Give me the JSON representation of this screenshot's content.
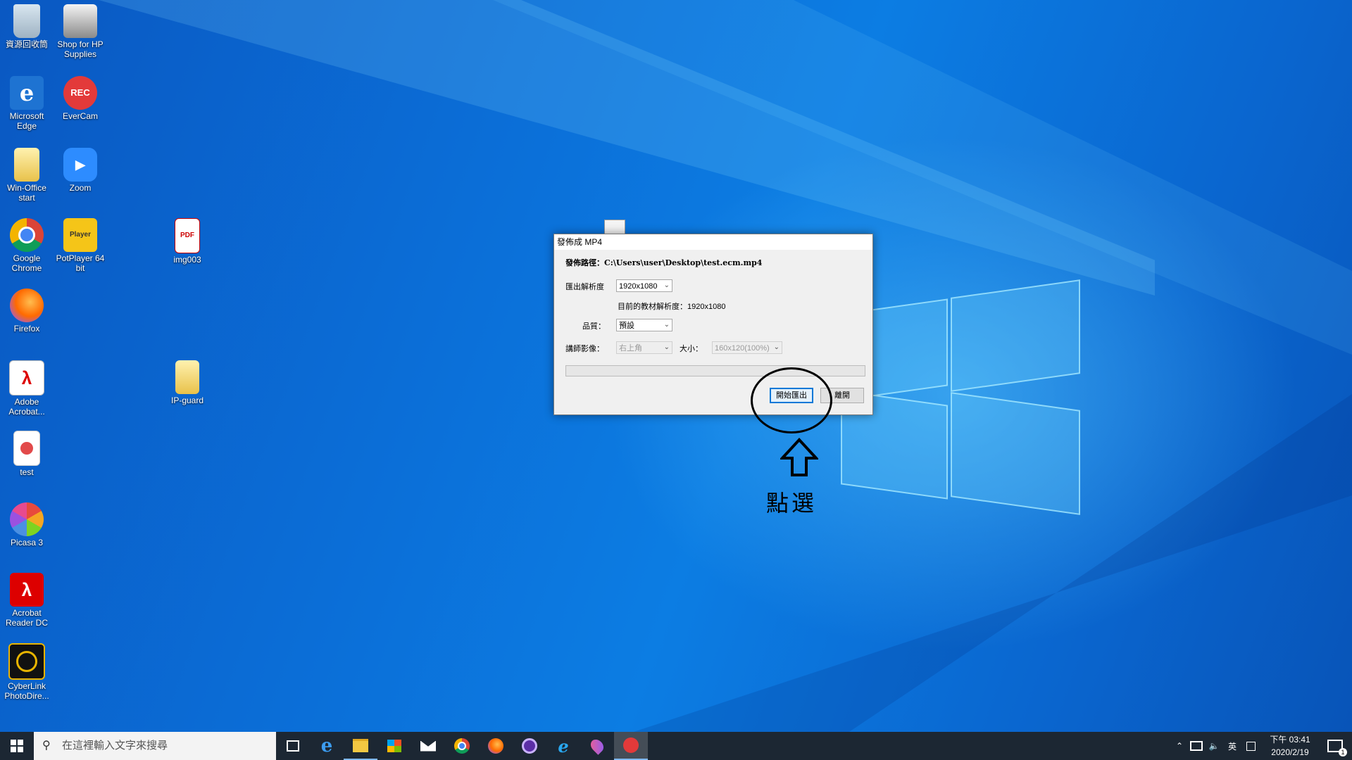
{
  "desktop_icons": [
    {
      "label": "資源回收筒",
      "icon": "recycle-bin-icon"
    },
    {
      "label": "Shop for HP Supplies",
      "icon": "printer-icon"
    },
    {
      "label": "Microsoft Edge",
      "icon": "edge-icon"
    },
    {
      "label": "EverCam",
      "icon": "evercam-icon",
      "badge": "REC"
    },
    {
      "label": "Win-Office start",
      "icon": "folder-icon"
    },
    {
      "label": "Zoom",
      "icon": "zoom-icon"
    },
    {
      "label": "Google Chrome",
      "icon": "chrome-icon"
    },
    {
      "label": "PotPlayer 64 bit",
      "icon": "potplayer-icon",
      "badge": "Player"
    },
    {
      "label": "img003",
      "icon": "pdf-file-icon",
      "badge": "PDF"
    },
    {
      "label": "Firefox",
      "icon": "firefox-icon"
    },
    {
      "label": "Adobe Acrobat...",
      "icon": "acrobat-icon"
    },
    {
      "label": "IP-guard",
      "icon": "folder-icon"
    },
    {
      "label": "test",
      "icon": "document-icon"
    },
    {
      "label": "Picasa 3",
      "icon": "picasa-icon"
    },
    {
      "label": "Acrobat Reader DC",
      "icon": "acrobat-reader-icon"
    },
    {
      "label": "CyberLink PhotoDire...",
      "icon": "cyberlink-icon"
    }
  ],
  "dialog": {
    "title": "發佈成 MP4",
    "path_label": "發佈路徑：",
    "path_value": "C:\\Users\\user\\Desktop\\test.ecm.mp4",
    "resolution_label": "匯出解析度",
    "resolution_value": "1920x1080",
    "current_resolution_text": "目前的教材解析度：1920x1080",
    "quality_label": "品質：",
    "quality_value": "預設",
    "lecturer_label": "講師影像：",
    "lecturer_position": "右上角",
    "size_label": "大小：",
    "size_value": "160x120(100%)",
    "progress": 0,
    "start_button": "開始匯出",
    "close_button": "離開"
  },
  "annotation": {
    "text": "點選",
    "arrow": "up-arrow-icon"
  },
  "taskbar": {
    "search_placeholder": "在這裡輸入文字來搜尋",
    "apps": [
      "task-view-icon",
      "edge-icon",
      "file-explorer-icon",
      "store-icon",
      "mail-icon",
      "chrome-icon",
      "firefox-icon",
      "obs-icon",
      "ie-icon",
      "maps-icon",
      "evercam-icon"
    ],
    "ime": "英",
    "time": "下午 03:41",
    "date": "2020/2/19",
    "notification_count": "1"
  },
  "colors": {
    "accent": "#0078d7",
    "taskbar": "#1c2733",
    "desktop": "#0b6fd8"
  }
}
